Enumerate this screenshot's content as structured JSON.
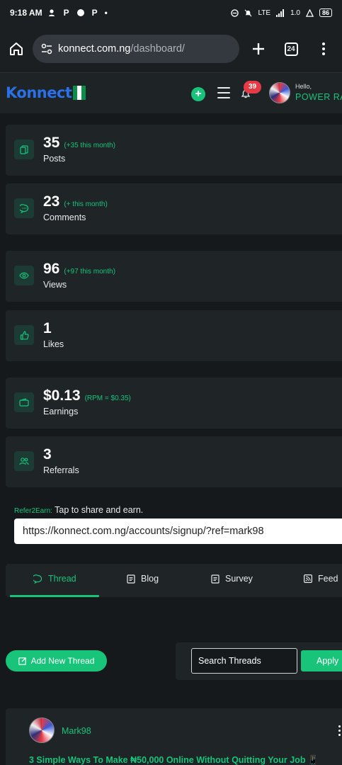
{
  "status_bar": {
    "time": "9:18 AM",
    "notification_icons": [
      "person-icon",
      "P",
      "chat-icon",
      "P",
      "•"
    ],
    "network": "LTE",
    "speed": "1.0",
    "battery": "86"
  },
  "browser": {
    "url_domain": "konnect.com.ng",
    "url_path": "/dashboard/",
    "tab_count": "24"
  },
  "header": {
    "logo_text": "Konnect",
    "notification_count": "39",
    "greeting": "Hello,",
    "user_name": "POWER RAN"
  },
  "stats": [
    {
      "value": "35",
      "extra": "(+35 this month)",
      "label": "Posts",
      "icon": "copy-icon"
    },
    {
      "value": "23",
      "extra": "(+ this month)",
      "label": "Comments",
      "icon": "comment-icon"
    },
    {
      "value": "96",
      "extra": "(+97 this month)",
      "label": "Views",
      "icon": "eye-icon"
    },
    {
      "value": "1",
      "extra": "",
      "label": "Likes",
      "icon": "thumbs-up-icon"
    },
    {
      "value": "$0.13",
      "extra": "(RPM = $0.35)",
      "label": "Earnings",
      "icon": "wallet-icon"
    },
    {
      "value": "3",
      "extra": "",
      "label": "Referrals",
      "icon": "users-icon"
    }
  ],
  "refer": {
    "tag": "Refer2Earn:",
    "text": "Tap to share and earn.",
    "link": "https://konnect.com.ng/accounts/signup/?ref=mark98"
  },
  "tabs": [
    {
      "label": "Thread",
      "icon": "comment-icon",
      "active": true
    },
    {
      "label": "Blog",
      "icon": "document-icon",
      "active": false
    },
    {
      "label": "Survey",
      "icon": "document-icon",
      "active": false
    },
    {
      "label": "Feed",
      "icon": "rss-icon",
      "active": false
    }
  ],
  "actions": {
    "add_thread": "Add New Thread",
    "search_placeholder": "Search Threads",
    "apply": "Apply"
  },
  "thread": {
    "author": "Mark98",
    "title": "3 Simple Ways To Make ₦50,000 Online Without Quitting Your Job 📱"
  },
  "colors": {
    "accent": "#18c47a",
    "background": "#15191c",
    "card": "#1f2427",
    "badge": "#e53b46",
    "logo": "#2b70e6"
  }
}
